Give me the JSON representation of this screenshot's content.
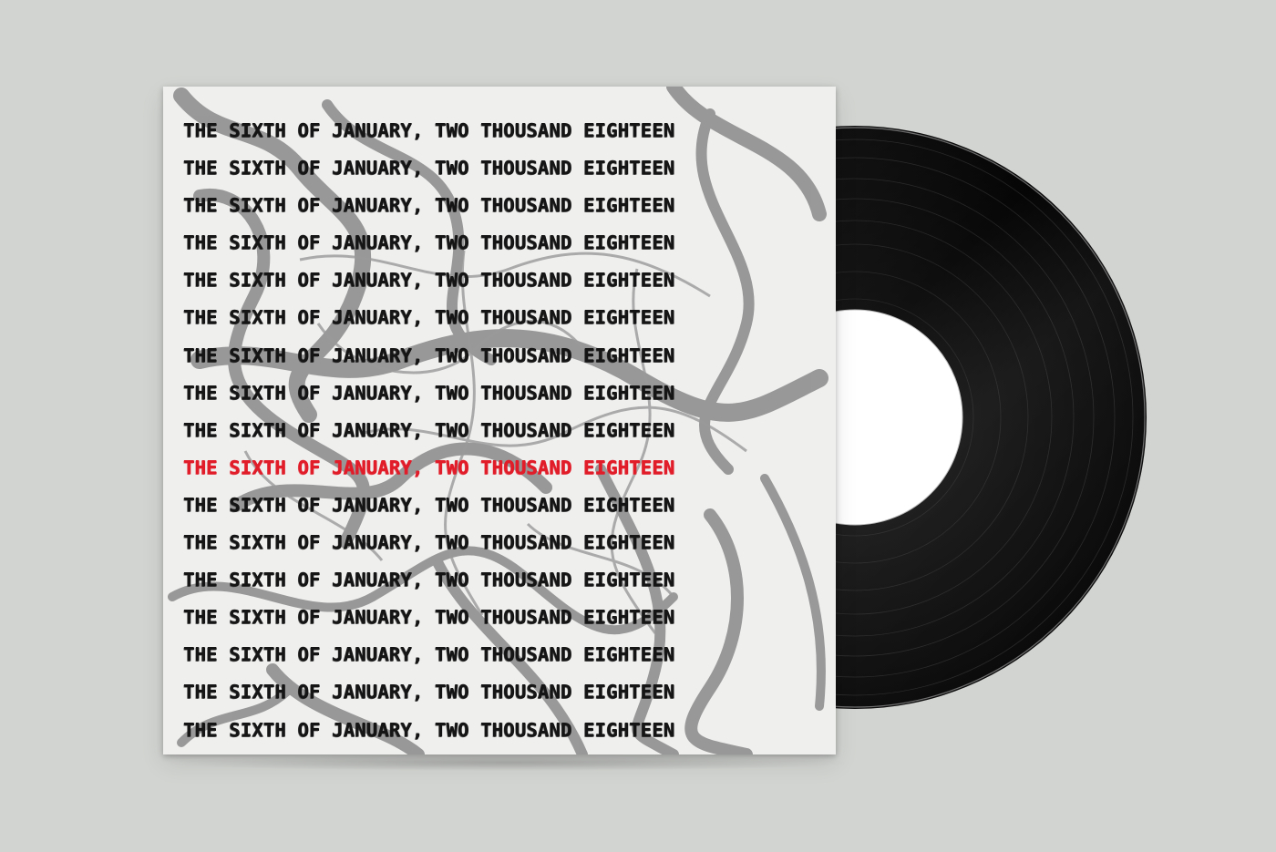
{
  "cover": {
    "lines": [
      "THE SIXTH OF JANUARY, TWO THOUSAND EIGHTEEN",
      "THE SIXTH OF JANUARY, TWO THOUSAND EIGHTEEN",
      "THE SIXTH OF JANUARY, TWO THOUSAND EIGHTEEN",
      "THE SIXTH OF JANUARY, TWO THOUSAND EIGHTEEN",
      "THE SIXTH OF JANUARY, TWO THOUSAND EIGHTEEN",
      "THE SIXTH OF JANUARY, TWO THOUSAND EIGHTEEN",
      "THE SIXTH OF JANUARY, TWO THOUSAND EIGHTEEN",
      "THE SIXTH OF JANUARY, TWO THOUSAND EIGHTEEN",
      "THE SIXTH OF JANUARY, TWO THOUSAND EIGHTEEN",
      "THE SIXTH OF JANUARY, TWO THOUSAND EIGHTEEN",
      "THE SIXTH OF JANUARY, TWO THOUSAND EIGHTEEN",
      "THE SIXTH OF JANUARY, TWO THOUSAND EIGHTEEN",
      "THE SIXTH OF JANUARY, TWO THOUSAND EIGHTEEN",
      "THE SIXTH OF JANUARY, TWO THOUSAND EIGHTEEN",
      "THE SIXTH OF JANUARY, TWO THOUSAND EIGHTEEN",
      "THE SIXTH OF JANUARY, TWO THOUSAND EIGHTEEN",
      "THE SIXTH OF JANUARY, TWO THOUSAND EIGHTEEN"
    ],
    "highlight_line_index": 9
  },
  "colors": {
    "background": "#d2d4d1",
    "sleeve": "#efefee",
    "text": "#151515",
    "highlight": "#e11d2a",
    "vinyl": "#0c0c0c",
    "label": "#ffffff",
    "scribble": "#8a8a8a"
  }
}
